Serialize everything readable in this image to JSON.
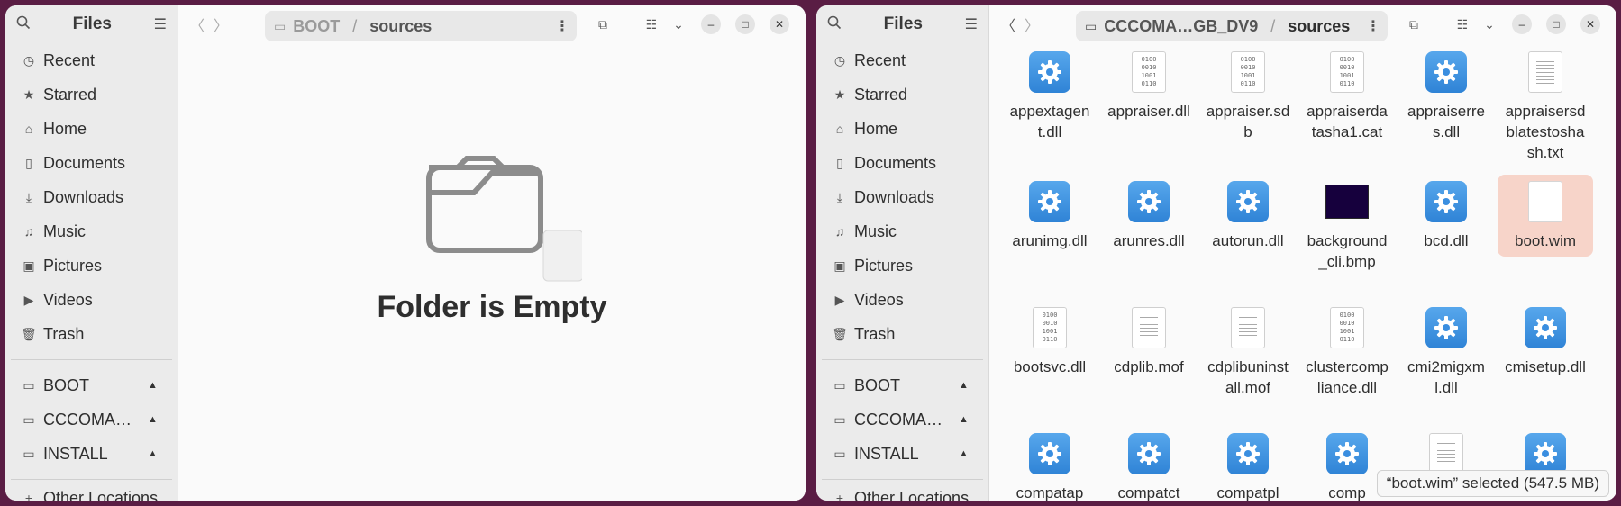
{
  "left_window": {
    "sidebar": {
      "title": "Files",
      "places": [
        {
          "label": "Recent",
          "icon": "clock-icon"
        },
        {
          "label": "Starred",
          "icon": "star-icon"
        },
        {
          "label": "Home",
          "icon": "home-icon"
        },
        {
          "label": "Documents",
          "icon": "document-icon"
        },
        {
          "label": "Downloads",
          "icon": "download-icon"
        },
        {
          "label": "Music",
          "icon": "music-icon"
        },
        {
          "label": "Pictures",
          "icon": "picture-icon"
        },
        {
          "label": "Videos",
          "icon": "video-icon"
        },
        {
          "label": "Trash",
          "icon": "trash-icon"
        }
      ],
      "drives": [
        {
          "label": "BOOT"
        },
        {
          "label": "CCCOMA…"
        },
        {
          "label": "INSTALL"
        }
      ],
      "other_locations": "Other Locations"
    },
    "path": {
      "root": "BOOT",
      "current": "sources"
    },
    "empty_message": "Folder is Empty"
  },
  "right_window": {
    "sidebar": {
      "title": "Files",
      "places": [
        {
          "label": "Recent",
          "icon": "clock-icon"
        },
        {
          "label": "Starred",
          "icon": "star-icon"
        },
        {
          "label": "Home",
          "icon": "home-icon"
        },
        {
          "label": "Documents",
          "icon": "document-icon"
        },
        {
          "label": "Downloads",
          "icon": "download-icon"
        },
        {
          "label": "Music",
          "icon": "music-icon"
        },
        {
          "label": "Pictures",
          "icon": "picture-icon"
        },
        {
          "label": "Videos",
          "icon": "video-icon"
        },
        {
          "label": "Trash",
          "icon": "trash-icon"
        }
      ],
      "drives": [
        {
          "label": "BOOT"
        },
        {
          "label": "CCCOMA…"
        },
        {
          "label": "INSTALL"
        }
      ],
      "other_locations": "Other Locations"
    },
    "path": {
      "root": "CCCOMA…GB_DV9",
      "current": "sources"
    },
    "files": [
      {
        "name": "appextagent.dll",
        "kind": "gear"
      },
      {
        "name": "appraiser.dll",
        "kind": "binary"
      },
      {
        "name": "appraiser.sdb",
        "kind": "binary"
      },
      {
        "name": "appraiserdatasha1.cat",
        "kind": "binary"
      },
      {
        "name": "appraiserres.dll",
        "kind": "gear"
      },
      {
        "name": "appraisersdblatestoshash.txt",
        "kind": "text"
      },
      {
        "name": "arunimg.dll",
        "kind": "gear"
      },
      {
        "name": "arunres.dll",
        "kind": "gear"
      },
      {
        "name": "autorun.dll",
        "kind": "gear"
      },
      {
        "name": "background_cli.bmp",
        "kind": "image"
      },
      {
        "name": "bcd.dll",
        "kind": "gear"
      },
      {
        "name": "boot.wim",
        "kind": "blank",
        "selected": true
      },
      {
        "name": "bootsvc.dll",
        "kind": "binary"
      },
      {
        "name": "cdplib.mof",
        "kind": "text"
      },
      {
        "name": "cdplibuninstall.mof",
        "kind": "text"
      },
      {
        "name": "clustercompliance.dll",
        "kind": "binary"
      },
      {
        "name": "cmi2migxml.dll",
        "kind": "gear"
      },
      {
        "name": "cmisetup.dll",
        "kind": "gear"
      },
      {
        "name": "compatap",
        "kind": "gear"
      },
      {
        "name": "compatct",
        "kind": "gear"
      },
      {
        "name": "compatpl",
        "kind": "gear"
      },
      {
        "name": "comp",
        "kind": "gear"
      },
      {
        "name": "",
        "kind": "text"
      },
      {
        "name": "",
        "kind": "gear"
      }
    ],
    "status": "“boot.wim” selected  (547.5 MB)"
  },
  "binary_glyph": "0100\n0010\n1001\n0110"
}
